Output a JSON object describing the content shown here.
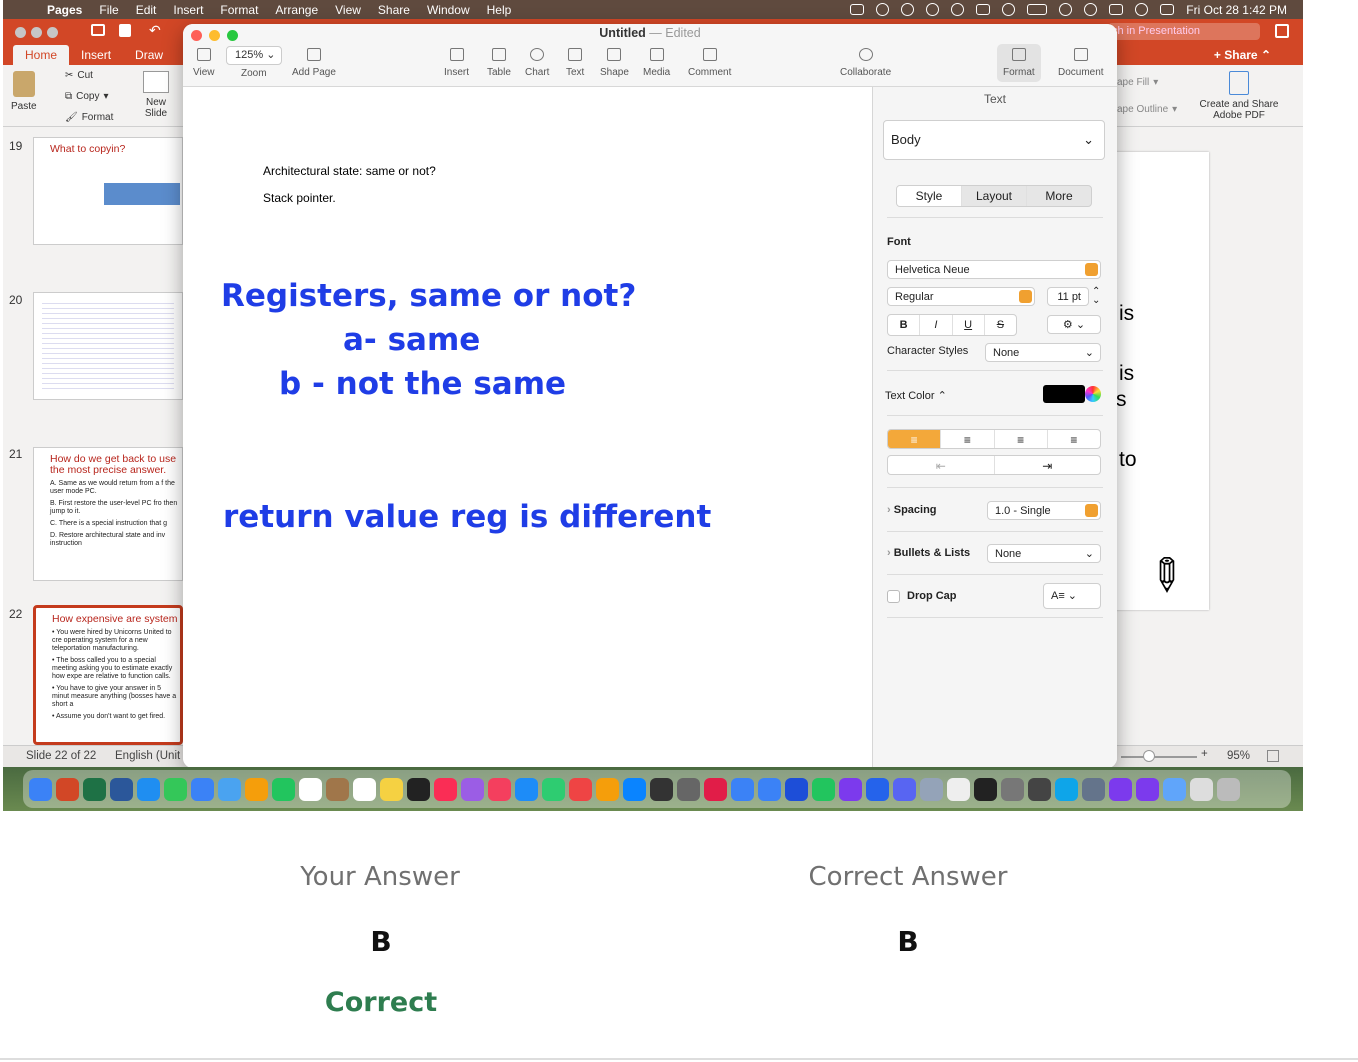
{
  "menubar": {
    "app": "Pages",
    "items": [
      "File",
      "Edit",
      "Insert",
      "Format",
      "Arrange",
      "View",
      "Share",
      "Window",
      "Help"
    ],
    "clock": "Fri Oct 28  1:42 PM"
  },
  "ppt": {
    "tabs": [
      "Home",
      "Insert",
      "Draw"
    ],
    "search": "ch in Presentation",
    "share": "Share",
    "ribbon": {
      "paste": "Paste",
      "cut": "Cut",
      "copy": "Copy",
      "format": "Format",
      "new_slide": "New Slide",
      "shape_fill": "ape Fill",
      "shape_outline": "ape Outline",
      "adobe": "Create and Share Adobe PDF"
    },
    "slides": [
      {
        "num": "19",
        "title": "What to copyin?"
      },
      {
        "num": "20",
        "title": ""
      },
      {
        "num": "21",
        "title": "How do we get back to use the most precise answer.",
        "lines": [
          "A. Same as we would return from a f the user mode PC.",
          "B. First restore the user-level PC fro then jump to it.",
          "C. There is a special instruction that g",
          "D. Restore architectural state and inv instruction"
        ]
      },
      {
        "num": "22",
        "title": "How expensive are system",
        "lines": [
          "• You were hired by Unicorns United to cre operating system for a new teleportation manufacturing.",
          "• The boss called you to a special meeting asking you to estimate exactly how expe are relative to function calls.",
          "• You have to give your answer in 5 minut measure anything (bosses have a short a",
          "• Assume you don't want to get fired."
        ]
      }
    ],
    "status_slide": "Slide 22 of 22",
    "status_lang": "English (Unit",
    "zoom": "95%",
    "side_text": [
      "is",
      "is",
      "s",
      "to"
    ]
  },
  "pages": {
    "title": "Untitled",
    "edited": "— Edited",
    "toolbar": {
      "view": "View",
      "zoom_value": "125%",
      "zoom": "Zoom",
      "add_page": "Add Page",
      "insert": "Insert",
      "table": "Table",
      "chart": "Chart",
      "text": "Text",
      "shape": "Shape",
      "media": "Media",
      "comment": "Comment",
      "collaborate": "Collaborate",
      "format": "Format",
      "document": "Document"
    },
    "doc": {
      "line1": "Architectural state: same or not?",
      "line2": "Stack pointer.",
      "h1": "Registers, same or not?",
      "h2": "a- same",
      "h3": "b - not the same",
      "h4": "return value reg is different"
    },
    "inspector": {
      "header": "Text",
      "style": "Body",
      "tabs": [
        "Style",
        "Layout",
        "More"
      ],
      "font_label": "Font",
      "font": "Helvetica Neue",
      "typeface": "Regular",
      "size": "11 pt",
      "b": "B",
      "i": "I",
      "u": "U",
      "s": "S",
      "char_styles_label": "Character Styles",
      "char_styles": "None",
      "text_color": "Text Color",
      "spacing_label": "Spacing",
      "spacing": "1.0 - Single",
      "bullets_label": "Bullets & Lists",
      "bullets": "None",
      "dropcap_label": "Drop Cap"
    }
  },
  "answer": {
    "your_label": "Your Answer",
    "your": "B",
    "correct_label": "Correct Answer",
    "correct": "B",
    "result": "Correct"
  }
}
